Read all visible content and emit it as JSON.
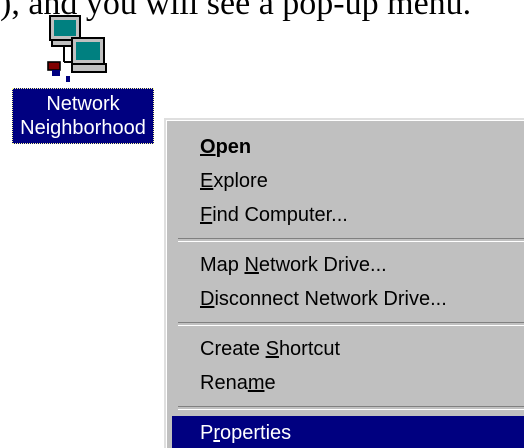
{
  "caption": "), and you will see a pop-up menu.",
  "desktop_icon": {
    "icon": "network-neighborhood-icon",
    "label_line1": "Network",
    "label_line2": "Neighborhood"
  },
  "context_menu": {
    "items": [
      {
        "label": "Open",
        "accel_index": 0,
        "default": true,
        "highlighted": false
      },
      {
        "label": "Explore",
        "accel_index": 0,
        "default": false,
        "highlighted": false
      },
      {
        "label": "Find Computer...",
        "accel_index": 0,
        "default": false,
        "highlighted": false
      },
      {
        "label": "Map Network Drive...",
        "accel_index": 4,
        "default": false,
        "highlighted": false
      },
      {
        "label": "Disconnect Network Drive...",
        "accel_index": 0,
        "default": false,
        "highlighted": false
      },
      {
        "label": "Create Shortcut",
        "accel_index": 7,
        "default": false,
        "highlighted": false
      },
      {
        "label": "Rename",
        "accel_index": 4,
        "default": false,
        "highlighted": false
      },
      {
        "label": "Properties",
        "accel_index": 1,
        "default": false,
        "highlighted": true
      }
    ]
  },
  "colors": {
    "selection": "#000080",
    "menu_face": "#c0c0c0",
    "desktop": "#ffffff"
  }
}
